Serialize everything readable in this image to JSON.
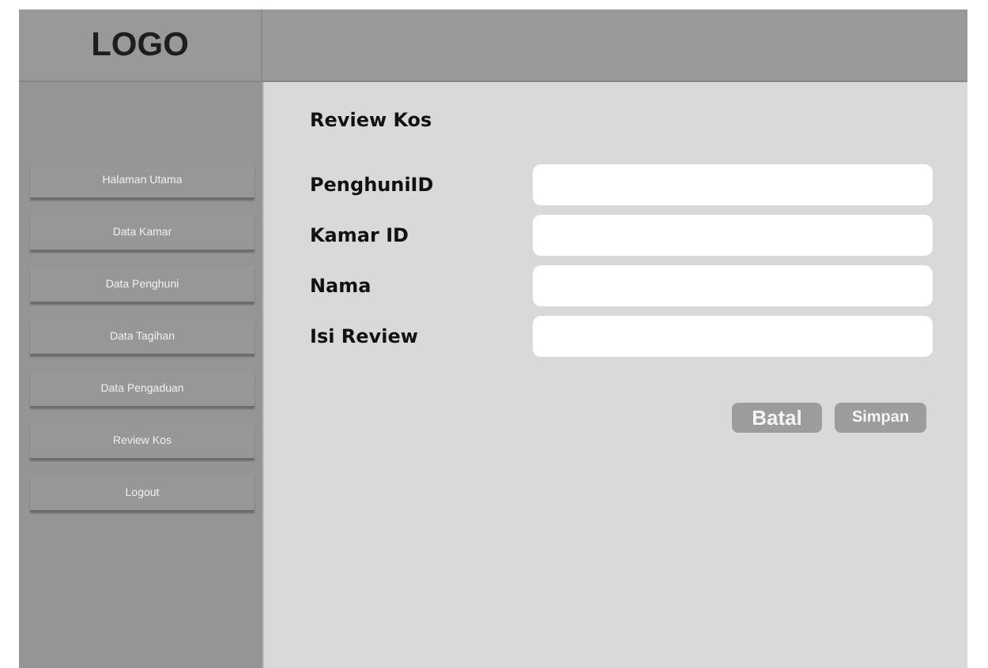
{
  "header": {
    "logo": "LOGO"
  },
  "sidebar": {
    "items": [
      {
        "label": "Halaman Utama"
      },
      {
        "label": "Data Kamar"
      },
      {
        "label": "Data Penghuni"
      },
      {
        "label": "Data Tagihan"
      },
      {
        "label": "Data Pengaduan"
      },
      {
        "label": "Review Kos"
      },
      {
        "label": "Logout"
      }
    ]
  },
  "main": {
    "title": "Review Kos",
    "fields": [
      {
        "label": "PenghuniID"
      },
      {
        "label": "Kamar ID"
      },
      {
        "label": "Nama"
      },
      {
        "label": "Isi Review"
      }
    ],
    "buttons": [
      {
        "label": "Batal",
        "kind": "large"
      },
      {
        "label": "Simpan",
        "kind": "small"
      }
    ]
  }
}
